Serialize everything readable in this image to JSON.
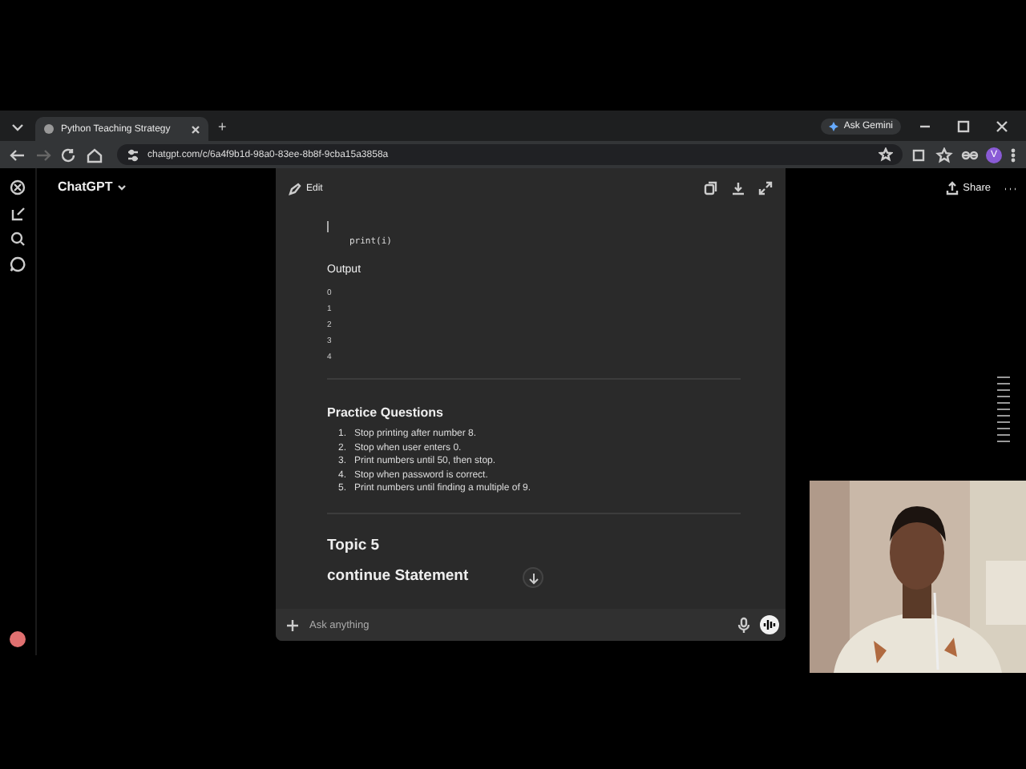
{
  "browser": {
    "tabs": [
      {
        "title": "Python Teaching Strategy",
        "selected": true
      }
    ],
    "new_tab": "+",
    "ask_gemini": "Ask Gemini",
    "url": "chatgpt.com/c/6a4f9b1d-98a0-83ee-8b8f-9cba15a3858a",
    "profile": "V"
  },
  "app": {
    "brand": "ChatGPT",
    "share": "Share"
  },
  "canvas": {
    "edit": "Edit",
    "code_line": "print(i)",
    "output_heading": "Output",
    "output_lines": [
      "0",
      "1",
      "2",
      "3",
      "4"
    ],
    "practice_heading": "Practice Questions",
    "questions": [
      {
        "number": "1.",
        "text": "Stop printing after number 8."
      },
      {
        "number": "2.",
        "text": "Stop when user enters 0."
      },
      {
        "number": "3.",
        "text": "Print numbers until 50, then stop."
      },
      {
        "number": "4.",
        "text": "Stop when password is correct."
      },
      {
        "number": "5.",
        "text": "Print numbers until finding a multiple of 9."
      }
    ],
    "topic_heading": "Topic 5",
    "topic_subheading": "continue Statement"
  },
  "composer": {
    "placeholder": "Ask anything"
  }
}
